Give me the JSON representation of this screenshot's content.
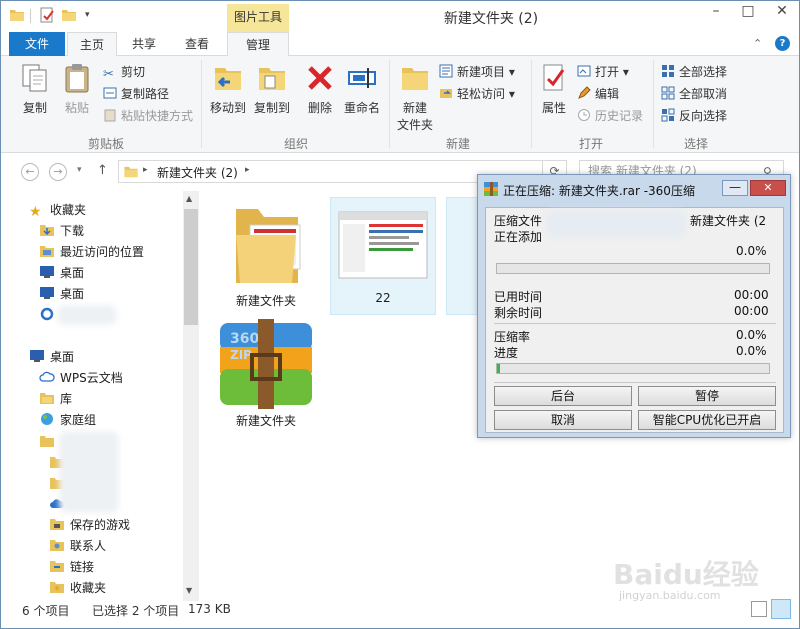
{
  "window": {
    "title": "新建文件夹 (2)"
  },
  "ribbon": {
    "tabs": [
      "文件",
      "主页",
      "共享",
      "查看",
      "管理"
    ],
    "context_header": "图片工具",
    "groups": {
      "clipboard": {
        "label": "剪贴板",
        "copy": "复制",
        "paste": "粘贴",
        "cut": "剪切",
        "copy_path": "复制路径",
        "paste_shortcut": "粘贴快捷方式"
      },
      "organize": {
        "label": "组织",
        "move_to": "移动到",
        "copy_to": "复制到",
        "delete": "删除",
        "rename": "重命名"
      },
      "new": {
        "label": "新建",
        "new_folder_line1": "新建",
        "new_folder_line2": "文件夹",
        "new_item": "新建项目",
        "easy_access": "轻松访问"
      },
      "open": {
        "label": "打开",
        "properties": "属性",
        "open": "打开",
        "edit": "编辑",
        "history": "历史记录"
      },
      "select": {
        "label": "选择",
        "select_all": "全部选择",
        "select_none": "全部取消",
        "invert": "反向选择"
      }
    }
  },
  "address": {
    "path": "新建文件夹 (2)",
    "search_placeholder": "搜索 新建文件夹 (2)"
  },
  "nav": {
    "favorites": "收藏夹",
    "items": [
      "下载",
      "最近访问的位置",
      "桌面",
      "桌面"
    ],
    "desktop": "桌面",
    "tree": [
      "WPS云文档",
      "库",
      "家庭组"
    ],
    "sub": [
      "保存的游戏",
      "联系人",
      "链接",
      "收藏夹"
    ]
  },
  "files": [
    {
      "name": "新建文件夹",
      "type": "folder"
    },
    {
      "name": "22",
      "type": "image"
    },
    {
      "name": "新建文件夹",
      "type": "archive"
    }
  ],
  "status": {
    "count": "6 个项目",
    "selected": "已选择 2 个项目",
    "size": "173 KB"
  },
  "dialog": {
    "title": "正在压缩: 新建文件夹.rar -360压缩",
    "file_label": "压缩文件",
    "file_value": "新建文件夹 (2",
    "adding": "正在添加",
    "pct1": "0.0%",
    "elapsed_label": "已用时间",
    "elapsed": "00:00",
    "remaining_label": "剩余时间",
    "remaining": "00:00",
    "ratio_label": "压缩率",
    "ratio": "0.0%",
    "progress_label": "进度",
    "progress": "0.0%",
    "btn_background": "后台",
    "btn_pause": "暂停",
    "btn_cancel": "取消",
    "btn_cpu": "智能CPU优化已开启"
  },
  "watermark": {
    "line1": "Baidu经验",
    "line2": "jingyan.baidu.com"
  }
}
